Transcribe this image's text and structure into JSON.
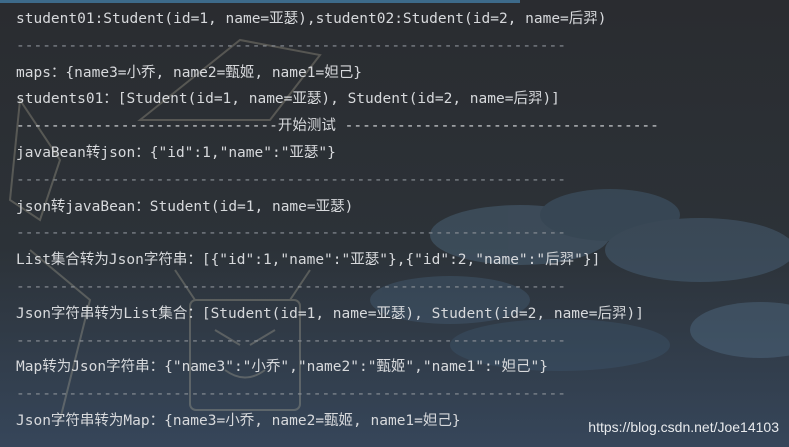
{
  "console": {
    "lines": [
      "student01:Student(id=1, name=亚瑟),student02:Student(id=2, name=后羿)",
      "---------------------------------------------------------------",
      "maps：{name3=小乔, name2=甄姬, name1=妲己}",
      "students01：[Student(id=1, name=亚瑟), Student(id=2, name=后羿)]",
      "------------------------------开始测试 ------------------------------------",
      "javaBean转json：{\"id\":1,\"name\":\"亚瑟\"}",
      "---------------------------------------------------------------",
      "json转javaBean：Student(id=1, name=亚瑟)",
      "---------------------------------------------------------------",
      "List集合转为Json字符串：[{\"id\":1,\"name\":\"亚瑟\"},{\"id\":2,\"name\":\"后羿\"}]",
      "---------------------------------------------------------------",
      "Json字符串转为List集合：[Student(id=1, name=亚瑟), Student(id=2, name=后羿)]",
      "---------------------------------------------------------------",
      "Map转为Json字符串：{\"name3\":\"小乔\",\"name2\":\"甄姬\",\"name1\":\"妲己\"}",
      "---------------------------------------------------------------",
      "Json字符串转为Map：{name3=小乔, name2=甄姬, name1=妲己}"
    ]
  },
  "watermark": "https://blog.csdn.net/Joe14103",
  "colors": {
    "background": "#2b2d30",
    "text": "#d7d9dc",
    "separator": "#8a8f96"
  }
}
